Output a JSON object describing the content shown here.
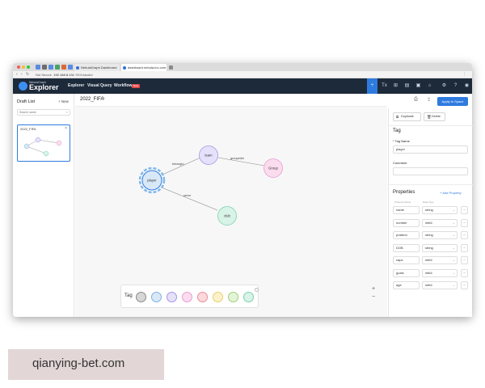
{
  "browser": {
    "tabs": [
      "NebulaGraph Dashboard",
      "dashboard.nebula-inc.com"
    ],
    "url_prefix": "Not Secure",
    "url": "192.168.8.131",
    "url_suffix": ":7001/studio/"
  },
  "app": {
    "brand_small": "NebulaGraph",
    "brand": "Explorer",
    "nav": [
      "Explorer",
      "Visual Query",
      "Workflow"
    ],
    "beta": "Beta"
  },
  "left_panel": {
    "title": "Draft List",
    "new_label": "+ New",
    "search_placeholder": "Search name",
    "draft_card": {
      "title": "2022_FIFA"
    }
  },
  "canvas": {
    "draft_name": "2022_FIFA",
    "apply_button": "Apply to Space",
    "nodes": {
      "team": "team",
      "player": "player",
      "group": "Group",
      "club": "club"
    },
    "edges": {
      "belongto": "belongto",
      "groupedin": "groupedin",
      "serve": "serve"
    }
  },
  "palette": {
    "label": "Tag",
    "colors": [
      "#d6d6d6",
      "#d8e8f7",
      "#e6e1fa",
      "#fbdcef",
      "#fbd9dd",
      "#fbf2c9",
      "#e3f4d6",
      "#d8f3e7"
    ],
    "borders": [
      "#8a8a8a",
      "#7fb0e0",
      "#a593e5",
      "#e79ccf",
      "#ea8d99",
      "#e6cf6b",
      "#9ccf7c",
      "#7fd0ac"
    ]
  },
  "zoom": {
    "in": "+",
    "out": "−"
  },
  "right_panel": {
    "duplicate": "Duplicate",
    "delete": "Delete",
    "section_tag": "Tag",
    "tag_name_label": "* Tag Name",
    "tag_name_value": "player",
    "comment_label": "Comment",
    "comment_value": "",
    "properties_title": "Properties",
    "add_property": "+ Add Property",
    "col_name": "Property Name",
    "col_type": "Data Type",
    "properties": [
      {
        "name": "name",
        "type": "string"
      },
      {
        "name": "number",
        "type": "int64"
      },
      {
        "name": "position",
        "type": "string"
      },
      {
        "name": "DOB",
        "type": "string"
      },
      {
        "name": "caps",
        "type": "int64"
      },
      {
        "name": "goals",
        "type": "int64"
      },
      {
        "name": "age",
        "type": "int64"
      }
    ]
  },
  "watermark": "qianying-bet.com"
}
